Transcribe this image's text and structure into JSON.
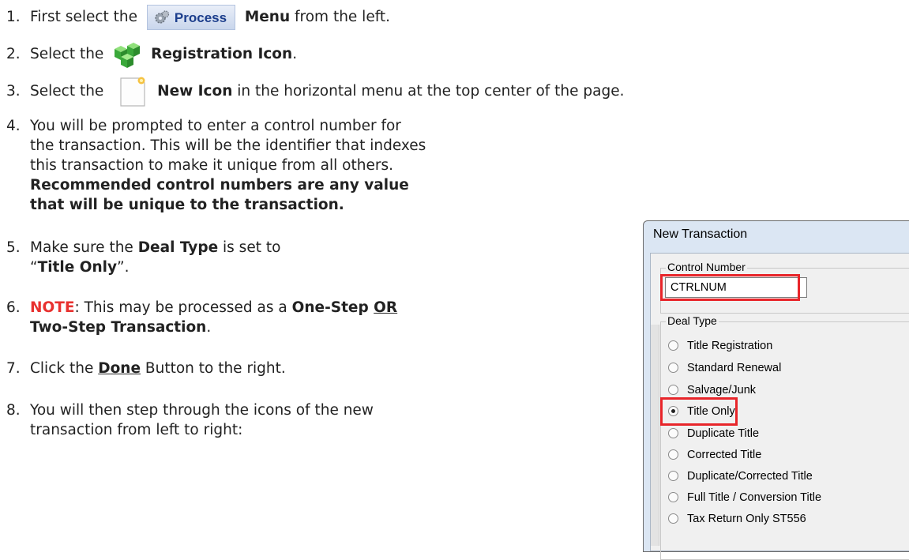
{
  "steps": {
    "s1": {
      "num": "1.",
      "pre": "First select the",
      "button_label": "Process",
      "bold": "Menu",
      "post": " from the left."
    },
    "s2": {
      "num": "2.",
      "pre": "Select the",
      "bold": "Registration Icon",
      "post": "."
    },
    "s3": {
      "num": "3.",
      "pre": "Select the",
      "bold": "New Icon",
      "post": " in the horizontal menu at the top center of the page."
    },
    "s4": {
      "num": "4.",
      "line1": "You will be prompted to enter a control number for",
      "line2": "the transaction. This will be the identifier that indexes",
      "line3": "this transaction to make it unique from all others.",
      "bold1": "Recommended control numbers are any value",
      "bold2": "that will be unique to the transaction."
    },
    "s5": {
      "num": "5.",
      "pre": "Make sure the ",
      "bold": "Deal Type",
      "post": " is set to",
      "q_open": "“",
      "value": "Title Only",
      "q_close": "”."
    },
    "s6": {
      "num": "6.",
      "note": "NOTE",
      "mid": ": This may be processed as a ",
      "bold1": "One-Step ",
      "or": "OR",
      "bold2": "Two-Step Transaction",
      "post": "."
    },
    "s7": {
      "num": "7.",
      "pre": "Click the ",
      "done_first": "D",
      "done_rest": "one",
      "post": " Button to the right."
    },
    "s8": {
      "num": "8.",
      "line1": "You will then step through the icons of the new",
      "line2": "transaction from left to right:"
    }
  },
  "icons": {
    "process": "gear-icon",
    "registration": "registration-cubes-icon",
    "new": "new-document-icon"
  },
  "dialog": {
    "title": "New Transaction",
    "control_group": "Control Number",
    "control_value": "CTRLNUM",
    "deal_group": "Deal Type",
    "options": [
      {
        "label": "Title Registration",
        "selected": false
      },
      {
        "label": "Standard Renewal",
        "selected": false
      },
      {
        "label": "Salvage/Junk",
        "selected": false
      },
      {
        "label": "Title Only",
        "selected": true
      },
      {
        "label": "Duplicate Title",
        "selected": false
      },
      {
        "label": "Corrected Title",
        "selected": false
      },
      {
        "label": "Duplicate/Corrected Title",
        "selected": false
      },
      {
        "label": "Full Title / Conversion Title",
        "selected": false
      },
      {
        "label": "Tax Return Only ST556",
        "selected": false
      }
    ]
  },
  "colors": {
    "highlight": "#e8252a",
    "note": "#e8312f",
    "menu_text": "#1c3e8c"
  }
}
